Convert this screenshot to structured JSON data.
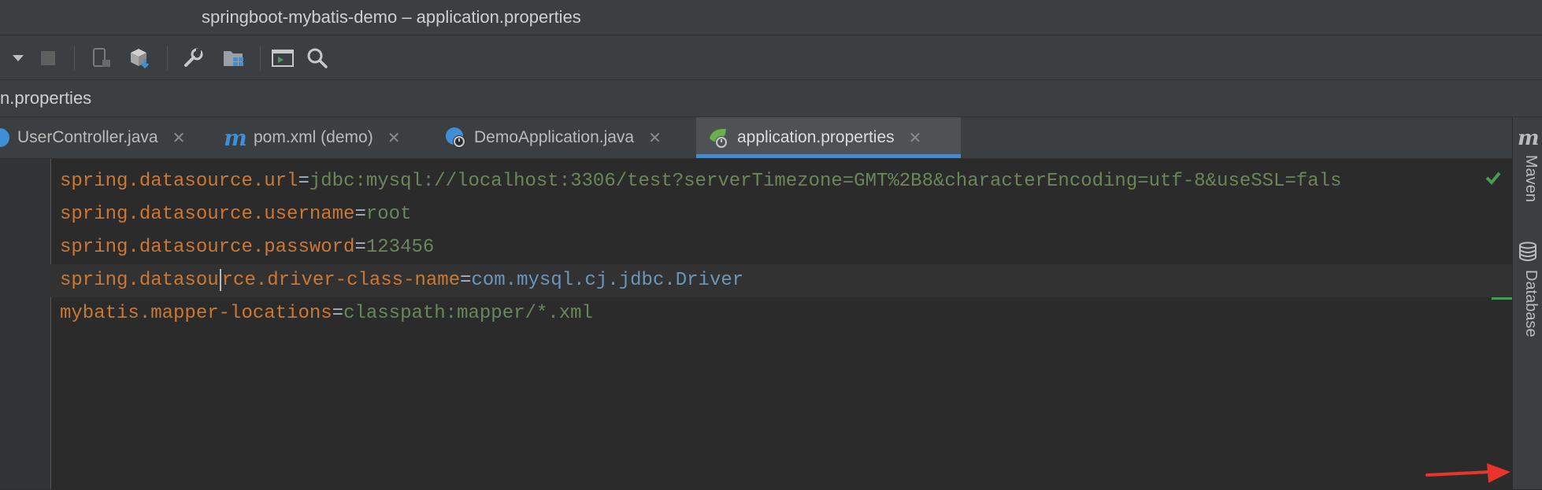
{
  "window": {
    "title": "springboot-mybatis-demo – application.properties"
  },
  "toolbar": {
    "icons": [
      "dropdown-arrow-icon",
      "stop-icon",
      "device-icon",
      "build-package-icon",
      "settings-wrench-icon",
      "project-structure-icon",
      "terminal-icon",
      "search-icon"
    ]
  },
  "navbar": {
    "breadcrumb": "n.properties"
  },
  "tabs": [
    {
      "label": "UserController.java",
      "icon": "java-class-icon",
      "active": false
    },
    {
      "label": "pom.xml (demo)",
      "icon": "maven-m-icon",
      "active": false
    },
    {
      "label": "DemoApplication.java",
      "icon": "spring-app-icon",
      "active": false
    },
    {
      "label": "application.properties",
      "icon": "spring-properties-icon",
      "active": true
    }
  ],
  "tab_close": "✕",
  "editor": {
    "lines": [
      {
        "key": "spring.datasource.url",
        "eq": "=",
        "value": "jdbc:mysql://localhost:3306/test?serverTimezone=GMT%2B8&characterEncoding=utf-8&useSSL=fals"
      },
      {
        "key": "spring.datasource.username",
        "eq": "=",
        "value": "root"
      },
      {
        "key": "spring.datasource.password",
        "eq": "=",
        "value": "123456"
      },
      {
        "key_before_caret": "spring.datasou",
        "key_after_caret": "rce.driver-class-name",
        "eq": "=",
        "value": "com.mysql.cj.jdbc.Driver"
      },
      {
        "key": "mybatis.mapper-locations",
        "eq": "=",
        "value": "classpath:mapper/*.xml"
      }
    ]
  },
  "right_panel": {
    "maven_icon": "m",
    "maven_label": "Maven",
    "database_label": "Database"
  },
  "colors": {
    "key": "#cc7832",
    "string_value": "#6a8759",
    "class_value": "#6897bb",
    "active_tab_underline": "#4a88c7",
    "annotation_arrow": "#e8342a"
  }
}
